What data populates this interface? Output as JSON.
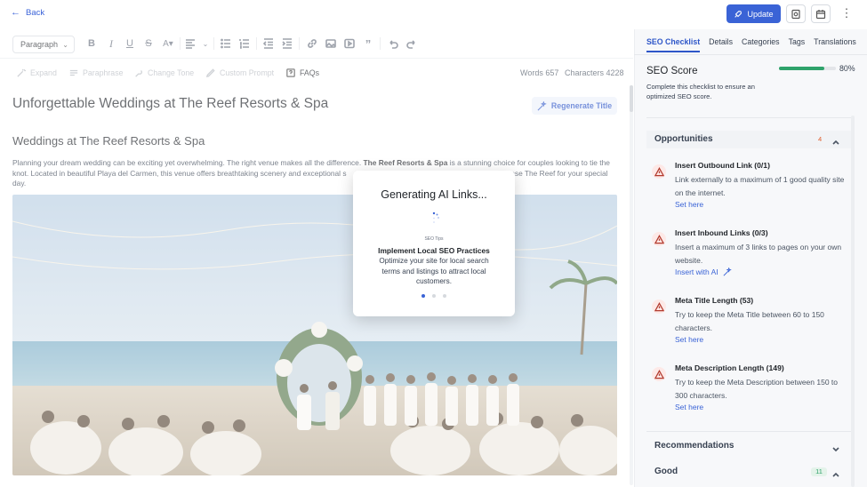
{
  "header": {
    "back_label": "Back",
    "update_label": "Update"
  },
  "toolbar": {
    "paragraph_select": "Paragraph"
  },
  "ai_toolbar": {
    "expand": "Expand",
    "paraphrase": "Paraphrase",
    "change_tone": "Change Tone",
    "custom_prompt": "Custom Prompt",
    "faqs": "FAQs",
    "words": "Words 657",
    "characters": "Characters 4228"
  },
  "editor": {
    "title": "Unforgettable Weddings at The Reef Resorts & Spa",
    "regenerate_title": "Regenerate Title",
    "section_heading": "Weddings at The Reef Resorts & Spa",
    "intro_part1": "Planning your dream wedding can be exciting yet overwhelming. The right venue makes all the difference. ",
    "intro_bold": "The Reef Resorts & Spa",
    "intro_part2": " is a stunning choice for couples looking to tie the knot. Located in beautiful Playa del Carmen, this venue offers breathtaking scenery and exceptional s",
    "intro_part3": "oose The Reef for your special day."
  },
  "modal": {
    "title": "Generating AI Links...",
    "tips_label": "SEO Tips",
    "tip_title": "Implement Local SEO Practices",
    "tip_body": "Optimize your site for local search terms and listings to attract local customers.",
    "active_dot": 0
  },
  "panel": {
    "tabs": [
      "SEO Checklist",
      "Details",
      "Categories",
      "Tags",
      "Translations"
    ],
    "score_label": "SEO Score",
    "score_value": 0.8,
    "score_pct": "80%",
    "score_desc": "Complete this checklist to ensure an optimized SEO score.",
    "opportunities_title": "Opportunities",
    "opportunities_count": "4",
    "opportunities": [
      {
        "title": "Insert Outbound Link (0/1)",
        "body": "Link externally to a maximum of 1 good quality site on the internet.",
        "link": "Set here"
      },
      {
        "title": "Insert Inbound Links (0/3)",
        "body": "Insert a maximum of 3 links to pages on your own website.",
        "link": "Insert with AI"
      },
      {
        "title": "Meta Title Length (53)",
        "body": "Try to keep the Meta Title between 60 to 150 characters.",
        "link": "Set here"
      },
      {
        "title": "Meta Description Length (149)",
        "body": "Try to keep the Meta Description between 150 to 300 characters.",
        "link": "Set here"
      }
    ],
    "recommendations_title": "Recommendations",
    "good_title": "Good",
    "good_count": "11"
  },
  "colors": {
    "accent": "#3a63d6",
    "score_green": "#2fa36b",
    "warning": "#b23b2e"
  }
}
